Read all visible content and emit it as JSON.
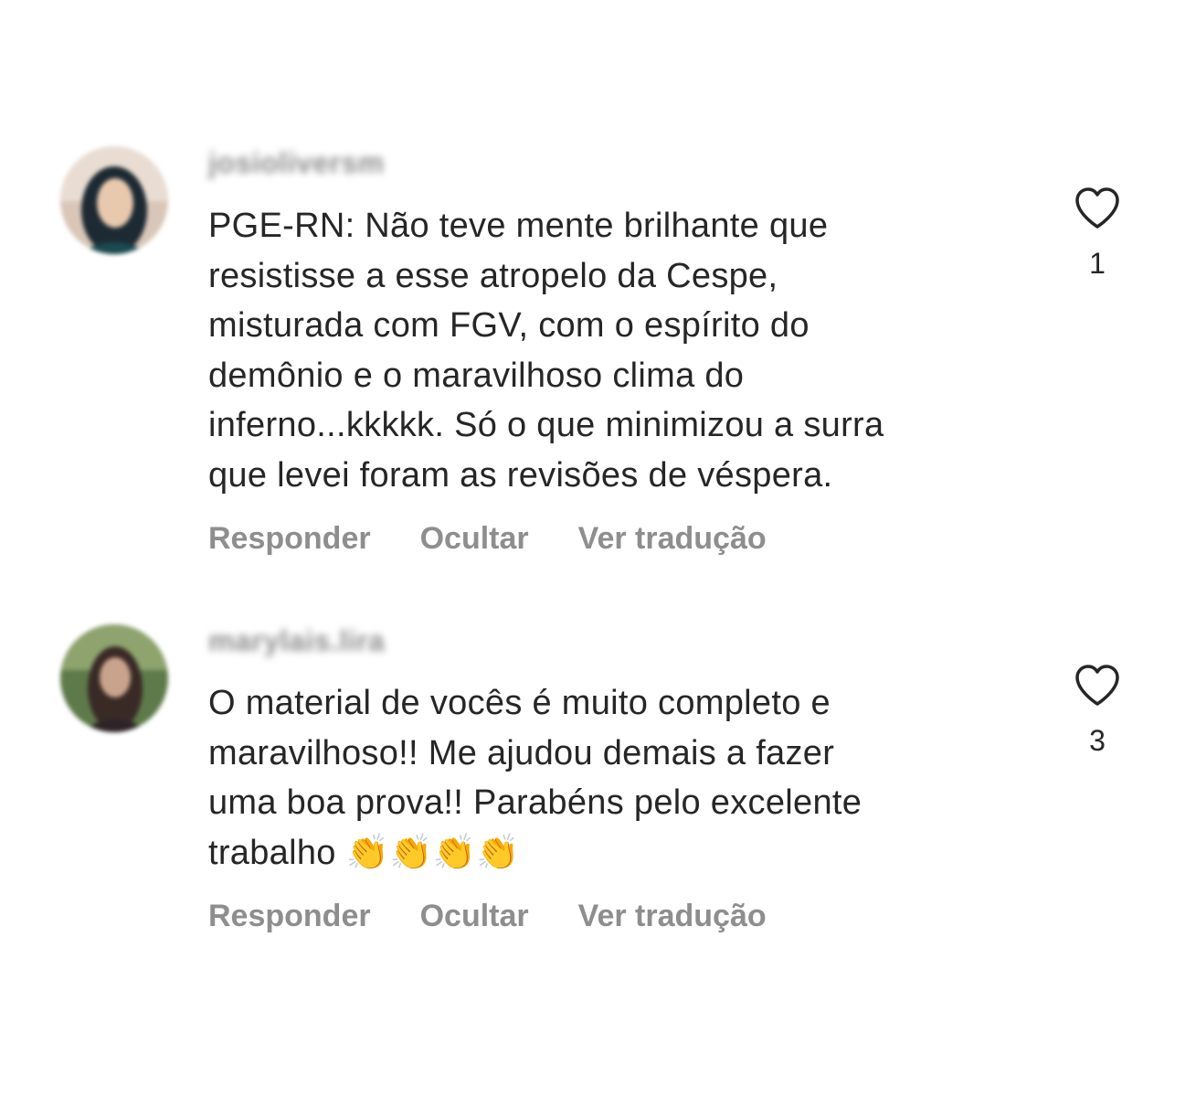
{
  "comments": [
    {
      "username": "josioliversm",
      "text": "PGE-RN: Não teve mente brilhante que resistisse a esse atropelo da Cespe, misturada com FGV, com o espírito do demônio e o maravilhoso clima do inferno...kkkkk. Só o que minimizou a surra que levei foram as revisões de véspera.",
      "lines": [
        "PGE-RN: Não teve mente brilhante que",
        "resistisse a esse atropelo da Cespe,",
        "misturada com FGV, com o espírito do",
        "demônio e o maravilhoso clima do",
        "inferno...kkkkk. Só o que minimizou a surra",
        "que levei foram as revisões de véspera."
      ],
      "like_count": "1",
      "actions": {
        "reply": "Responder",
        "hide": "Ocultar",
        "translate": "Ver tradução"
      },
      "avatar_icon": "user-avatar-icon"
    },
    {
      "username": "marylais.lira",
      "lines": [
        "O material de vocês é muito completo e",
        "maravilhoso!! Me ajudou demais a fazer",
        "uma boa prova!! Parabéns pelo excelente",
        "trabalho "
      ],
      "emoji": "👏👏👏👏",
      "like_count": "3",
      "actions": {
        "reply": "Responder",
        "hide": "Ocultar",
        "translate": "Ver tradução"
      },
      "avatar_icon": "user-avatar-icon"
    }
  ],
  "colors": {
    "text": "#262626",
    "secondary": "#8e8e8e",
    "background": "#ffffff"
  },
  "icons": {
    "like": "heart-outline-icon",
    "clap": "clapping-hands-emoji"
  }
}
